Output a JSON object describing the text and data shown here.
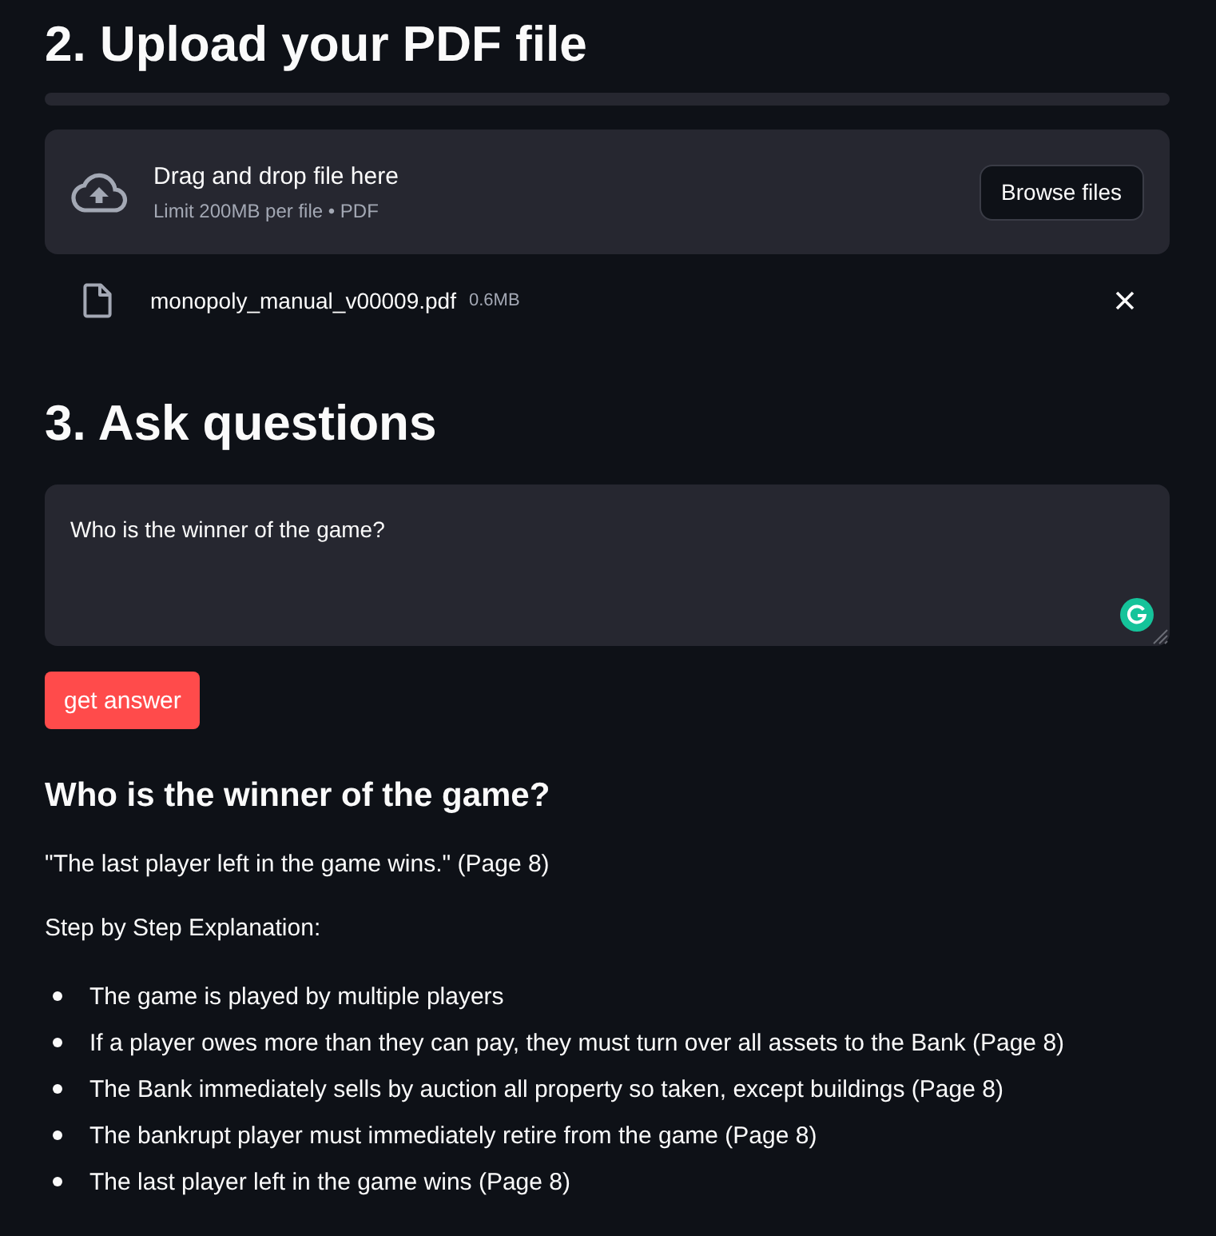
{
  "upload_section": {
    "heading": "2. Upload your PDF file",
    "progress": {
      "level": 0
    },
    "dropzone": {
      "title": "Drag and drop file here",
      "hint": "Limit 200MB per file • PDF",
      "button": "Browse files"
    },
    "files": [
      {
        "name": "monopoly_manual_v00009.pdf",
        "size": "0.6MB"
      }
    ]
  },
  "ask_section": {
    "heading": "3. Ask questions",
    "question_field": {
      "value": "Who is the winner of the game?"
    },
    "button": "get answer"
  },
  "answer": {
    "heading": "Who is the winner of the game?",
    "quote": "\"The last player left in the game wins.\" (Page 8)",
    "intro": "Step by Step Explanation:",
    "steps": [
      "The game is played by multiple players",
      "If a player owes more than they can pay, they must turn over all assets to the Bank (Page 8)",
      "The Bank immediately sells by auction all property so taken, except buildings (Page 8)",
      "The bankrupt player must immediately retire from the game (Page 8)",
      "The last player left in the game wins (Page 8)"
    ]
  }
}
